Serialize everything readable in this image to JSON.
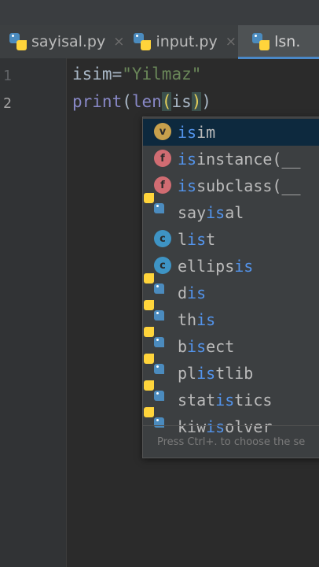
{
  "tabs": [
    {
      "label": "sayisal.py",
      "active": false
    },
    {
      "label": "input.py",
      "active": false
    },
    {
      "label": "lsn.",
      "active": true
    }
  ],
  "close_glyph": "×",
  "lines": [
    {
      "number": "1"
    },
    {
      "number": "2"
    }
  ],
  "code": {
    "line1": {
      "var": "isim",
      "op": "=",
      "str": "\"Yilmaz\""
    },
    "line2": {
      "fn1": "print",
      "p1": "(",
      "fn2": "len",
      "p2": "(",
      "arg": "is",
      "p3": ")",
      "p4": ")"
    }
  },
  "completion": {
    "items": [
      {
        "kind": "v",
        "match": "is",
        "rest": "im",
        "selected": true
      },
      {
        "kind": "f",
        "match": "is",
        "rest": "instance(__",
        "selected": false
      },
      {
        "kind": "f",
        "match": "is",
        "rest": "subclass(__",
        "selected": false
      },
      {
        "kind": "py",
        "pre": "say",
        "match": "is",
        "rest": "al",
        "selected": false
      },
      {
        "kind": "c",
        "pre": "l",
        "match": "is",
        "rest": "t",
        "selected": false
      },
      {
        "kind": "c",
        "pre": "ellips",
        "match": "is",
        "rest": "",
        "selected": false
      },
      {
        "kind": "py",
        "pre": "d",
        "match": "is",
        "rest": "",
        "selected": false
      },
      {
        "kind": "py",
        "pre": "th",
        "match": "is",
        "rest": "",
        "selected": false
      },
      {
        "kind": "py",
        "pre": "b",
        "match": "is",
        "rest": "ect",
        "selected": false
      },
      {
        "kind": "py",
        "pre": "pl",
        "match": "is",
        "rest": "tlib",
        "selected": false
      },
      {
        "kind": "py",
        "pre": "stat",
        "match": "is",
        "rest": "tics",
        "selected": false
      },
      {
        "kind": "py",
        "pre": "kiw",
        "match": "is",
        "rest": "olver",
        "selected": false
      }
    ],
    "hint": "Press Ctrl+. to choose the se"
  },
  "colors": {
    "selection": "#0d293e",
    "match": "#5394ec",
    "accent": "#4a88c7"
  }
}
